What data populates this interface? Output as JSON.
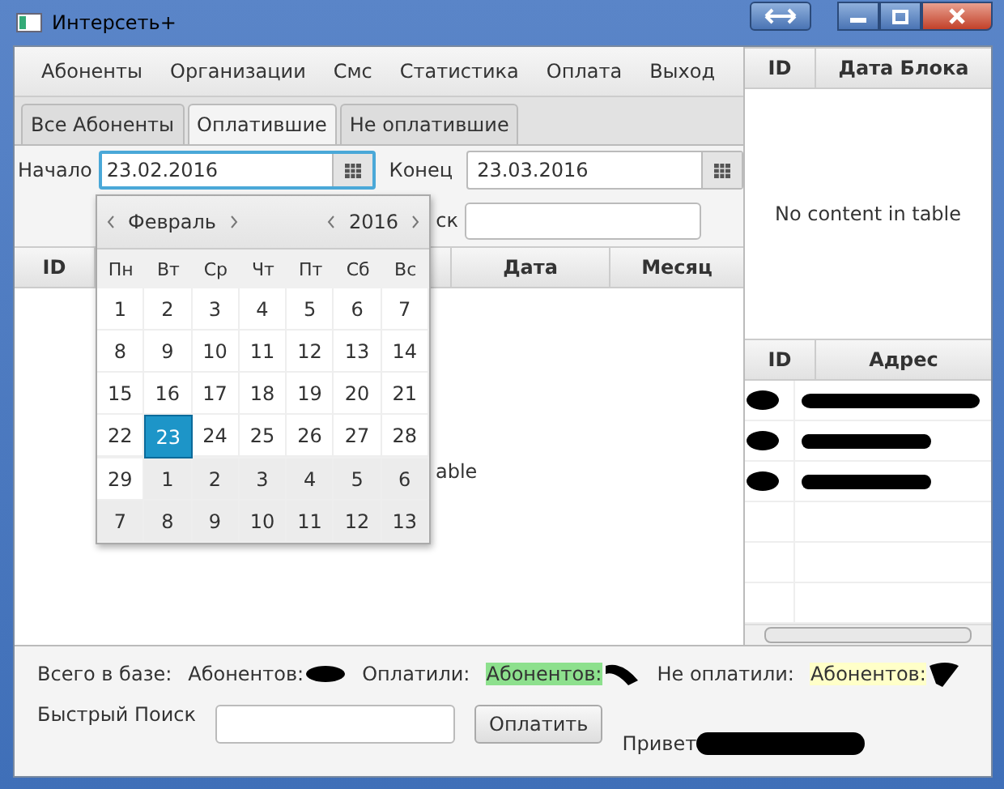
{
  "window": {
    "title": "Интерсеть+"
  },
  "menu": [
    "Абоненты",
    "Организации",
    "Смс",
    "Статистика",
    "Оплата",
    "Выход"
  ],
  "tabs": [
    {
      "label": "Все Абоненты",
      "selected": false
    },
    {
      "label": "Оплатившие",
      "selected": true
    },
    {
      "label": "Не оплатившие",
      "selected": false
    }
  ],
  "filters": {
    "start_label": "Начало",
    "start_value": "23.02.2016",
    "end_label": "Конец",
    "end_value": "23.03.2016",
    "search_label": "ск"
  },
  "date_picker": {
    "month": "Февраль",
    "year": "2016",
    "weekdays": [
      "Пн",
      "Вт",
      "Ср",
      "Чт",
      "Пт",
      "Сб",
      "Вс"
    ],
    "weeks": [
      [
        {
          "day": "1",
          "in_month": true,
          "selected": false
        },
        {
          "day": "2",
          "in_month": true,
          "selected": false
        },
        {
          "day": "3",
          "in_month": true,
          "selected": false
        },
        {
          "day": "4",
          "in_month": true,
          "selected": false
        },
        {
          "day": "5",
          "in_month": true,
          "selected": false
        },
        {
          "day": "6",
          "in_month": true,
          "selected": false
        },
        {
          "day": "7",
          "in_month": true,
          "selected": false
        }
      ],
      [
        {
          "day": "8",
          "in_month": true,
          "selected": false
        },
        {
          "day": "9",
          "in_month": true,
          "selected": false
        },
        {
          "day": "10",
          "in_month": true,
          "selected": false
        },
        {
          "day": "11",
          "in_month": true,
          "selected": false
        },
        {
          "day": "12",
          "in_month": true,
          "selected": false
        },
        {
          "day": "13",
          "in_month": true,
          "selected": false
        },
        {
          "day": "14",
          "in_month": true,
          "selected": false
        }
      ],
      [
        {
          "day": "15",
          "in_month": true,
          "selected": false
        },
        {
          "day": "16",
          "in_month": true,
          "selected": false
        },
        {
          "day": "17",
          "in_month": true,
          "selected": false
        },
        {
          "day": "18",
          "in_month": true,
          "selected": false
        },
        {
          "day": "19",
          "in_month": true,
          "selected": false
        },
        {
          "day": "20",
          "in_month": true,
          "selected": false
        },
        {
          "day": "21",
          "in_month": true,
          "selected": false
        }
      ],
      [
        {
          "day": "22",
          "in_month": true,
          "selected": false
        },
        {
          "day": "23",
          "in_month": true,
          "selected": true
        },
        {
          "day": "24",
          "in_month": true,
          "selected": false
        },
        {
          "day": "25",
          "in_month": true,
          "selected": false
        },
        {
          "day": "26",
          "in_month": true,
          "selected": false
        },
        {
          "day": "27",
          "in_month": true,
          "selected": false
        },
        {
          "day": "28",
          "in_month": true,
          "selected": false
        }
      ],
      [
        {
          "day": "29",
          "in_month": true,
          "selected": false
        },
        {
          "day": "1",
          "in_month": false,
          "selected": false
        },
        {
          "day": "2",
          "in_month": false,
          "selected": false
        },
        {
          "day": "3",
          "in_month": false,
          "selected": false
        },
        {
          "day": "4",
          "in_month": false,
          "selected": false
        },
        {
          "day": "5",
          "in_month": false,
          "selected": false
        },
        {
          "day": "6",
          "in_month": false,
          "selected": false
        }
      ],
      [
        {
          "day": "7",
          "in_month": false,
          "selected": false
        },
        {
          "day": "8",
          "in_month": false,
          "selected": false
        },
        {
          "day": "9",
          "in_month": false,
          "selected": false
        },
        {
          "day": "10",
          "in_month": false,
          "selected": false
        },
        {
          "day": "11",
          "in_month": false,
          "selected": false
        },
        {
          "day": "12",
          "in_month": false,
          "selected": false
        },
        {
          "day": "13",
          "in_month": false,
          "selected": false
        }
      ]
    ]
  },
  "main_table": {
    "columns": [
      "ID",
      "Дата",
      "Месяц"
    ],
    "placeholder": "able"
  },
  "block_table": {
    "columns": [
      "ID",
      "Дата Блока"
    ],
    "placeholder": "No content in table"
  },
  "address_table": {
    "columns": [
      "ID",
      "Адрес"
    ],
    "rows": [
      {
        "redacted": true
      },
      {
        "redacted": true
      },
      {
        "redacted": true
      },
      {
        "redacted": false
      },
      {
        "redacted": false
      },
      {
        "redacted": false
      }
    ]
  },
  "summary": {
    "total_label": "Всего в базе:",
    "total": "Абонентов:",
    "paid_label": "Оплатили:",
    "paid": "Абонентов:",
    "unpaid_label": "Не оплатили:",
    "unpaid": "Абонентов:"
  },
  "quick_search": {
    "label": "Быстрый Поиск"
  },
  "pay_button": "Оплатить",
  "greeting": "Привет"
}
